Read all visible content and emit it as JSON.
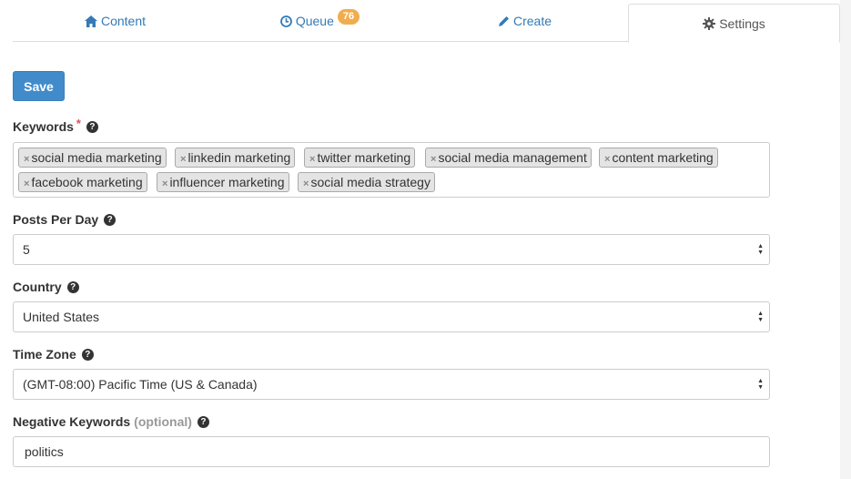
{
  "tabs": [
    {
      "label": "Content",
      "icon": "home-icon"
    },
    {
      "label": "Queue",
      "icon": "clock-icon",
      "badge": "76"
    },
    {
      "label": "Create",
      "icon": "pencil-icon"
    },
    {
      "label": "Settings",
      "icon": "gear-icon",
      "active": true
    }
  ],
  "save_label": "Save",
  "keywords": {
    "label": "Keywords",
    "required_mark": "*",
    "chips": [
      "social media marketing",
      "linkedin marketing",
      "twitter marketing",
      "social media management",
      "content marketing",
      "facebook marketing",
      "influencer marketing",
      "social media strategy"
    ],
    "remove_glyph": "×"
  },
  "posts_per_day": {
    "label": "Posts Per Day",
    "value": "5"
  },
  "country": {
    "label": "Country",
    "value": "United States"
  },
  "time_zone": {
    "label": "Time Zone",
    "value": "(GMT-08:00) Pacific Time (US & Canada)"
  },
  "negative_keywords": {
    "label": "Negative Keywords",
    "optional": "(optional)",
    "value": "politics"
  },
  "help_glyph": "?",
  "colors": {
    "link": "#337ab7",
    "primary": "#428bca",
    "badge": "#f0ad4e",
    "required": "#d9534f"
  }
}
